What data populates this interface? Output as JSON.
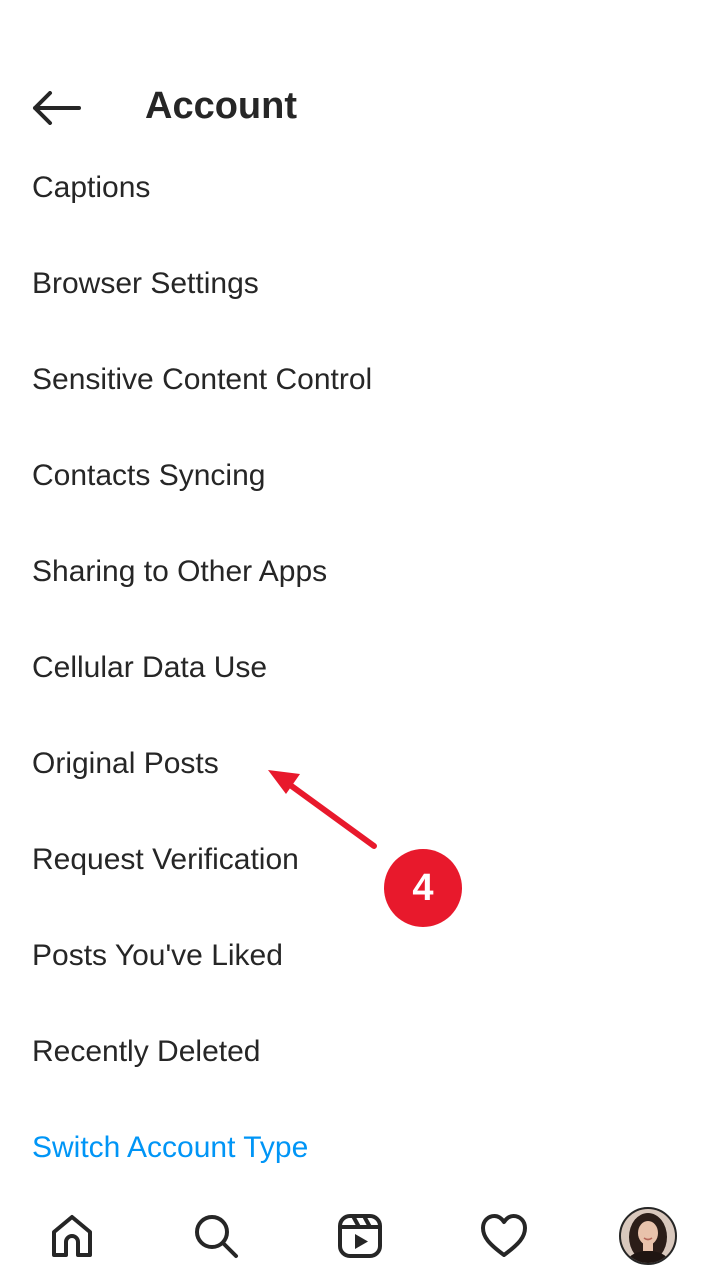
{
  "header": {
    "title": "Account",
    "back_icon": "arrow-left-icon"
  },
  "menu": {
    "items": [
      {
        "label": "Captions"
      },
      {
        "label": "Browser Settings"
      },
      {
        "label": "Sensitive Content Control"
      },
      {
        "label": "Contacts Syncing"
      },
      {
        "label": "Sharing to Other Apps"
      },
      {
        "label": "Cellular Data Use"
      },
      {
        "label": "Original Posts"
      },
      {
        "label": "Request Verification"
      },
      {
        "label": "Posts You've Liked"
      },
      {
        "label": "Recently Deleted"
      }
    ],
    "switch_account_label": "Switch Account Type"
  },
  "annotation": {
    "step_number": "4",
    "color": "#e8192c"
  },
  "tabbar": {
    "icons": [
      "home-icon",
      "search-icon",
      "reels-icon",
      "heart-icon",
      "profile-avatar"
    ]
  },
  "colors": {
    "text": "#262626",
    "link": "#0095f6",
    "background": "#ffffff"
  }
}
